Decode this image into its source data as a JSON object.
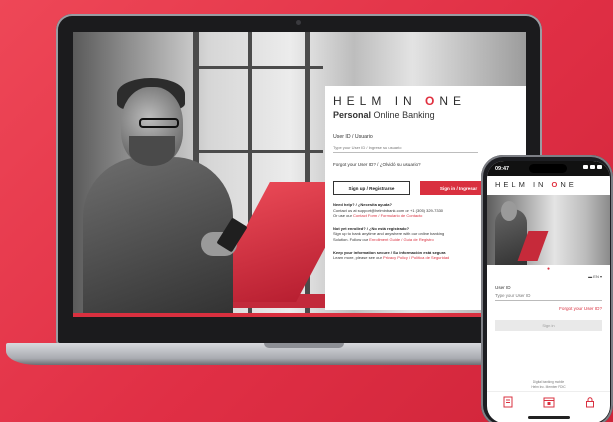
{
  "brand": {
    "logo_left": "HELM",
    "logo_mid": "IN",
    "logo_o": "O",
    "logo_right": "NE",
    "accent_color": "#d9303f",
    "background_color": "#e23246"
  },
  "desktop": {
    "subtitle_bold": "Personal",
    "subtitle_rest": "Online Banking",
    "userid_label": "User ID / Usuario",
    "userid_placeholder": "Type your User ID / Ingrese su usuario",
    "forgot_text": "Forgot your User ID? / ¿Olvidó su usuario?",
    "signup_button": "Sign up / Registrarse",
    "signin_button": "Sign in / Ingresar",
    "help_heading": "Need help? / ¿Necesita ayuda?",
    "help_line1": "Contact us at support@helminbank.com or +1 (305) 329-7330",
    "help_line2_pre": "Or use our ",
    "help_link": "Contact Form / Formulario de Contacto",
    "enroll_heading": "Not yet enrolled? / ¿No está registrado?",
    "enroll_line1": "Sign up to bank anytime and anywhere with our online banking",
    "enroll_line2_pre": "Solution. Follow our ",
    "enroll_link": "Enrollment Guide / Guía de Registro",
    "secure_heading": "Keep your information secure / Su información está segura",
    "secure_line_pre": "Learn more, please see our ",
    "secure_link": "Privacy Policy / Política de Seguridad"
  },
  "mobile": {
    "time": "09:47",
    "language": "EN",
    "userid_label": "User ID",
    "userid_placeholder": "Type your User ID",
    "forgot_text": "Forgot your User ID?",
    "signin_button": "Sign in",
    "footer_line1": "Digital banking mobile",
    "footer_line2": "Helm Inc. Member FDIC",
    "tabs": [
      {
        "icon": "document-icon"
      },
      {
        "icon": "calendar-icon"
      },
      {
        "icon": "lock-icon"
      }
    ]
  }
}
